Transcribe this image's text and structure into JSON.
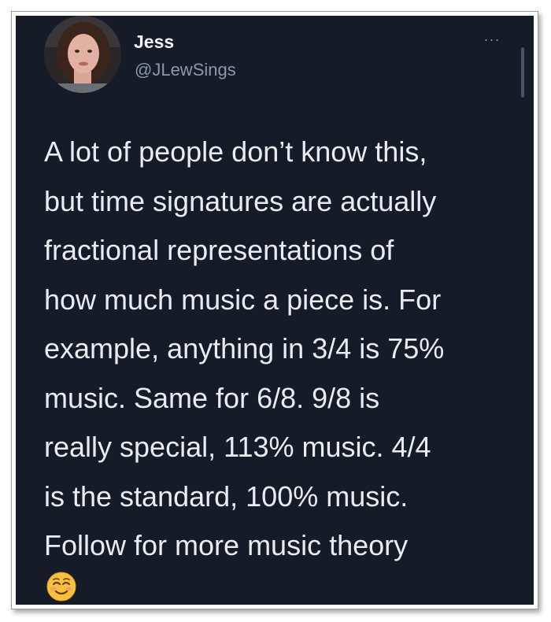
{
  "author": {
    "name": "Jess",
    "handle": "@JLewSings"
  },
  "menu": {
    "more_label": "···"
  },
  "tweet": {
    "lines": [
      "A lot of people don’t know this,",
      "but time signatures are actually",
      "fractional representations of",
      "how much music a piece is. For",
      "example, anything in 3/4 is 75%",
      "music. Same for 6/8. 9/8 is",
      "really special, 113% music. 4/4",
      "is the standard, 100% music.",
      "Follow for more music theory"
    ],
    "emoji": "☺️"
  },
  "colors": {
    "background": "#151c28",
    "text": "#e9ecef",
    "secondary_text": "#8b98a5"
  },
  "icons": [
    "avatar",
    "more-horizontal-icon",
    "smiling-face-emoji"
  ]
}
